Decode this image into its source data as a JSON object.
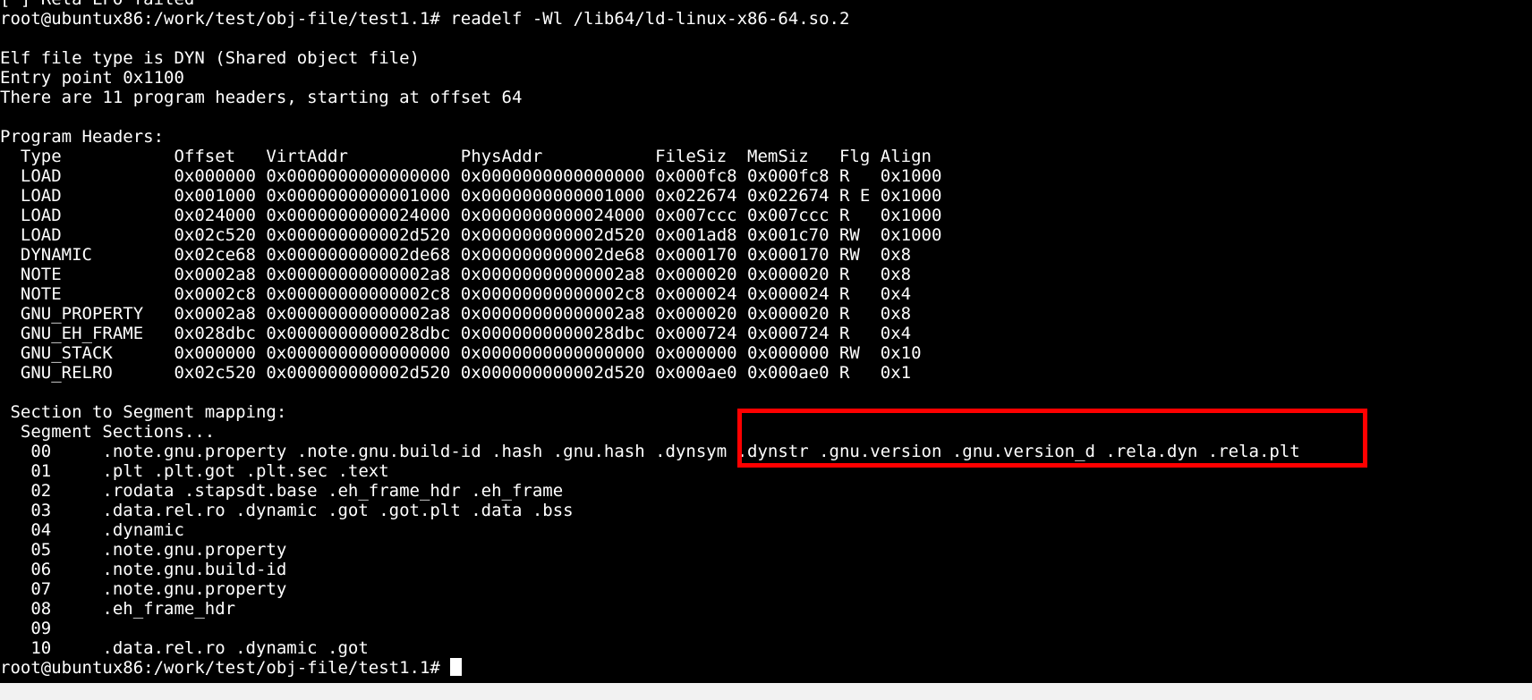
{
  "terminal": {
    "lines": [
      "[ ] Rela LFO failed",
      "root@ubuntux86:/work/test/obj-file/test1.1# readelf -Wl /lib64/ld-linux-x86-64.so.2",
      "",
      "Elf file type is DYN (Shared object file)",
      "Entry point 0x1100",
      "There are 11 program headers, starting at offset 64",
      "",
      "Program Headers:",
      "  Type           Offset   VirtAddr           PhysAddr           FileSiz  MemSiz   Flg Align",
      "  LOAD           0x000000 0x0000000000000000 0x0000000000000000 0x000fc8 0x000fc8 R   0x1000",
      "  LOAD           0x001000 0x0000000000001000 0x0000000000001000 0x022674 0x022674 R E 0x1000",
      "  LOAD           0x024000 0x0000000000024000 0x0000000000024000 0x007ccc 0x007ccc R   0x1000",
      "  LOAD           0x02c520 0x000000000002d520 0x000000000002d520 0x001ad8 0x001c70 RW  0x1000",
      "  DYNAMIC        0x02ce68 0x000000000002de68 0x000000000002de68 0x000170 0x000170 RW  0x8",
      "  NOTE           0x0002a8 0x00000000000002a8 0x00000000000002a8 0x000020 0x000020 R   0x8",
      "  NOTE           0x0002c8 0x00000000000002c8 0x00000000000002c8 0x000024 0x000024 R   0x4",
      "  GNU_PROPERTY   0x0002a8 0x00000000000002a8 0x00000000000002a8 0x000020 0x000020 R   0x8",
      "  GNU_EH_FRAME   0x028dbc 0x0000000000028dbc 0x0000000000028dbc 0x000724 0x000724 R   0x4",
      "  GNU_STACK      0x000000 0x0000000000000000 0x0000000000000000 0x000000 0x000000 RW  0x10",
      "  GNU_RELRO      0x02c520 0x000000000002d520 0x000000000002d520 0x000ae0 0x000ae0 R   0x1",
      "",
      " Section to Segment mapping:",
      "  Segment Sections...",
      "   00     .note.gnu.property .note.gnu.build-id .hash .gnu.hash .dynsym .dynstr .gnu.version .gnu.version_d .rela.dyn .rela.plt",
      "   01     .plt .plt.got .plt.sec .text",
      "   02     .rodata .stapsdt.base .eh_frame_hdr .eh_frame",
      "   03     .data.rel.ro .dynamic .got .got.plt .data .bss",
      "   04     .dynamic",
      "   05     .note.gnu.property",
      "   06     .note.gnu.build-id",
      "   07     .note.gnu.property",
      "   08     .eh_frame_hdr",
      "   09     ",
      "   10     .data.rel.ro .dynamic .got"
    ],
    "prompt": "root@ubuntux86:/work/test/obj-file/test1.1# "
  },
  "colors": {
    "background": "#000000",
    "foreground": "#ffffff",
    "highlight": "#ff0000"
  }
}
